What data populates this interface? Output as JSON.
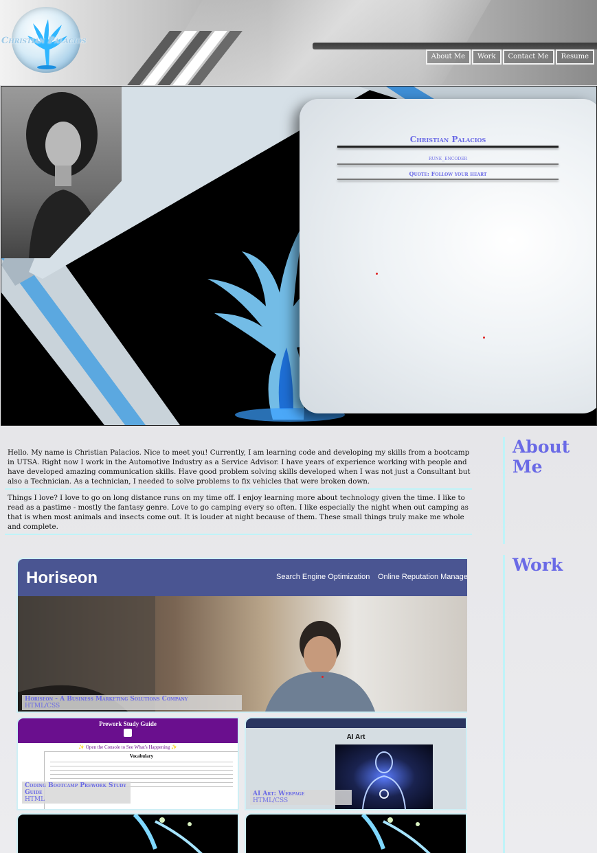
{
  "site": {
    "logo_text": "Christian Palacios"
  },
  "nav": {
    "items": [
      "About Me",
      "Work",
      "Contact Me",
      "Resume"
    ]
  },
  "profile": {
    "name": "Christian Palacios",
    "username": "rune_encoder",
    "quote": "Quote: Follow your heart"
  },
  "about": {
    "title": "About Me",
    "paragraphs": [
      "Hello. My name is Christian Palacios. Nice to meet you! Currently, I am learning code and developing my skills from a bootcamp in UTSA. Right now I work in the Automotive Industry as a Service Advisor. I have years of experience working with people and have developed amazing communication skills. Have good problem solving skills developed when I was not just a Consultant but also a Technician. As a technician, I needed to solve problems to fix vehicles that were broken down.",
      "Things I love? I love to go on long distance runs on my time off. I enjoy learning more about technology given the time. I like to read as a pastime - mostly the fantasy genre. Love to go camping every so often. I like especially the night when out camping as that is when most animals and insects come out. It is louder at night because of them. These small things truly make me whole and complete."
    ]
  },
  "work": {
    "title": "Work",
    "projects": [
      {
        "title": "Horiseon - A Business Marketing Solutions Company",
        "tech": "HTML/CSS",
        "preview": {
          "brand": "Horiseon",
          "nav_1": "Search Engine Optimization",
          "nav_2": "Online Reputation Managem"
        }
      },
      {
        "title": "Coding Bootcamp Prework Study Guide",
        "tech": "HTML",
        "preview": {
          "heading": "Prework Study Guide",
          "sub": "✨ Open the Console to See What's Happening ✨",
          "box_title": "Vocabulary"
        }
      },
      {
        "title": "AI Art: Webpage",
        "tech": "HTML/CSS",
        "preview": {
          "heading": "AI Art"
        }
      }
    ]
  }
}
